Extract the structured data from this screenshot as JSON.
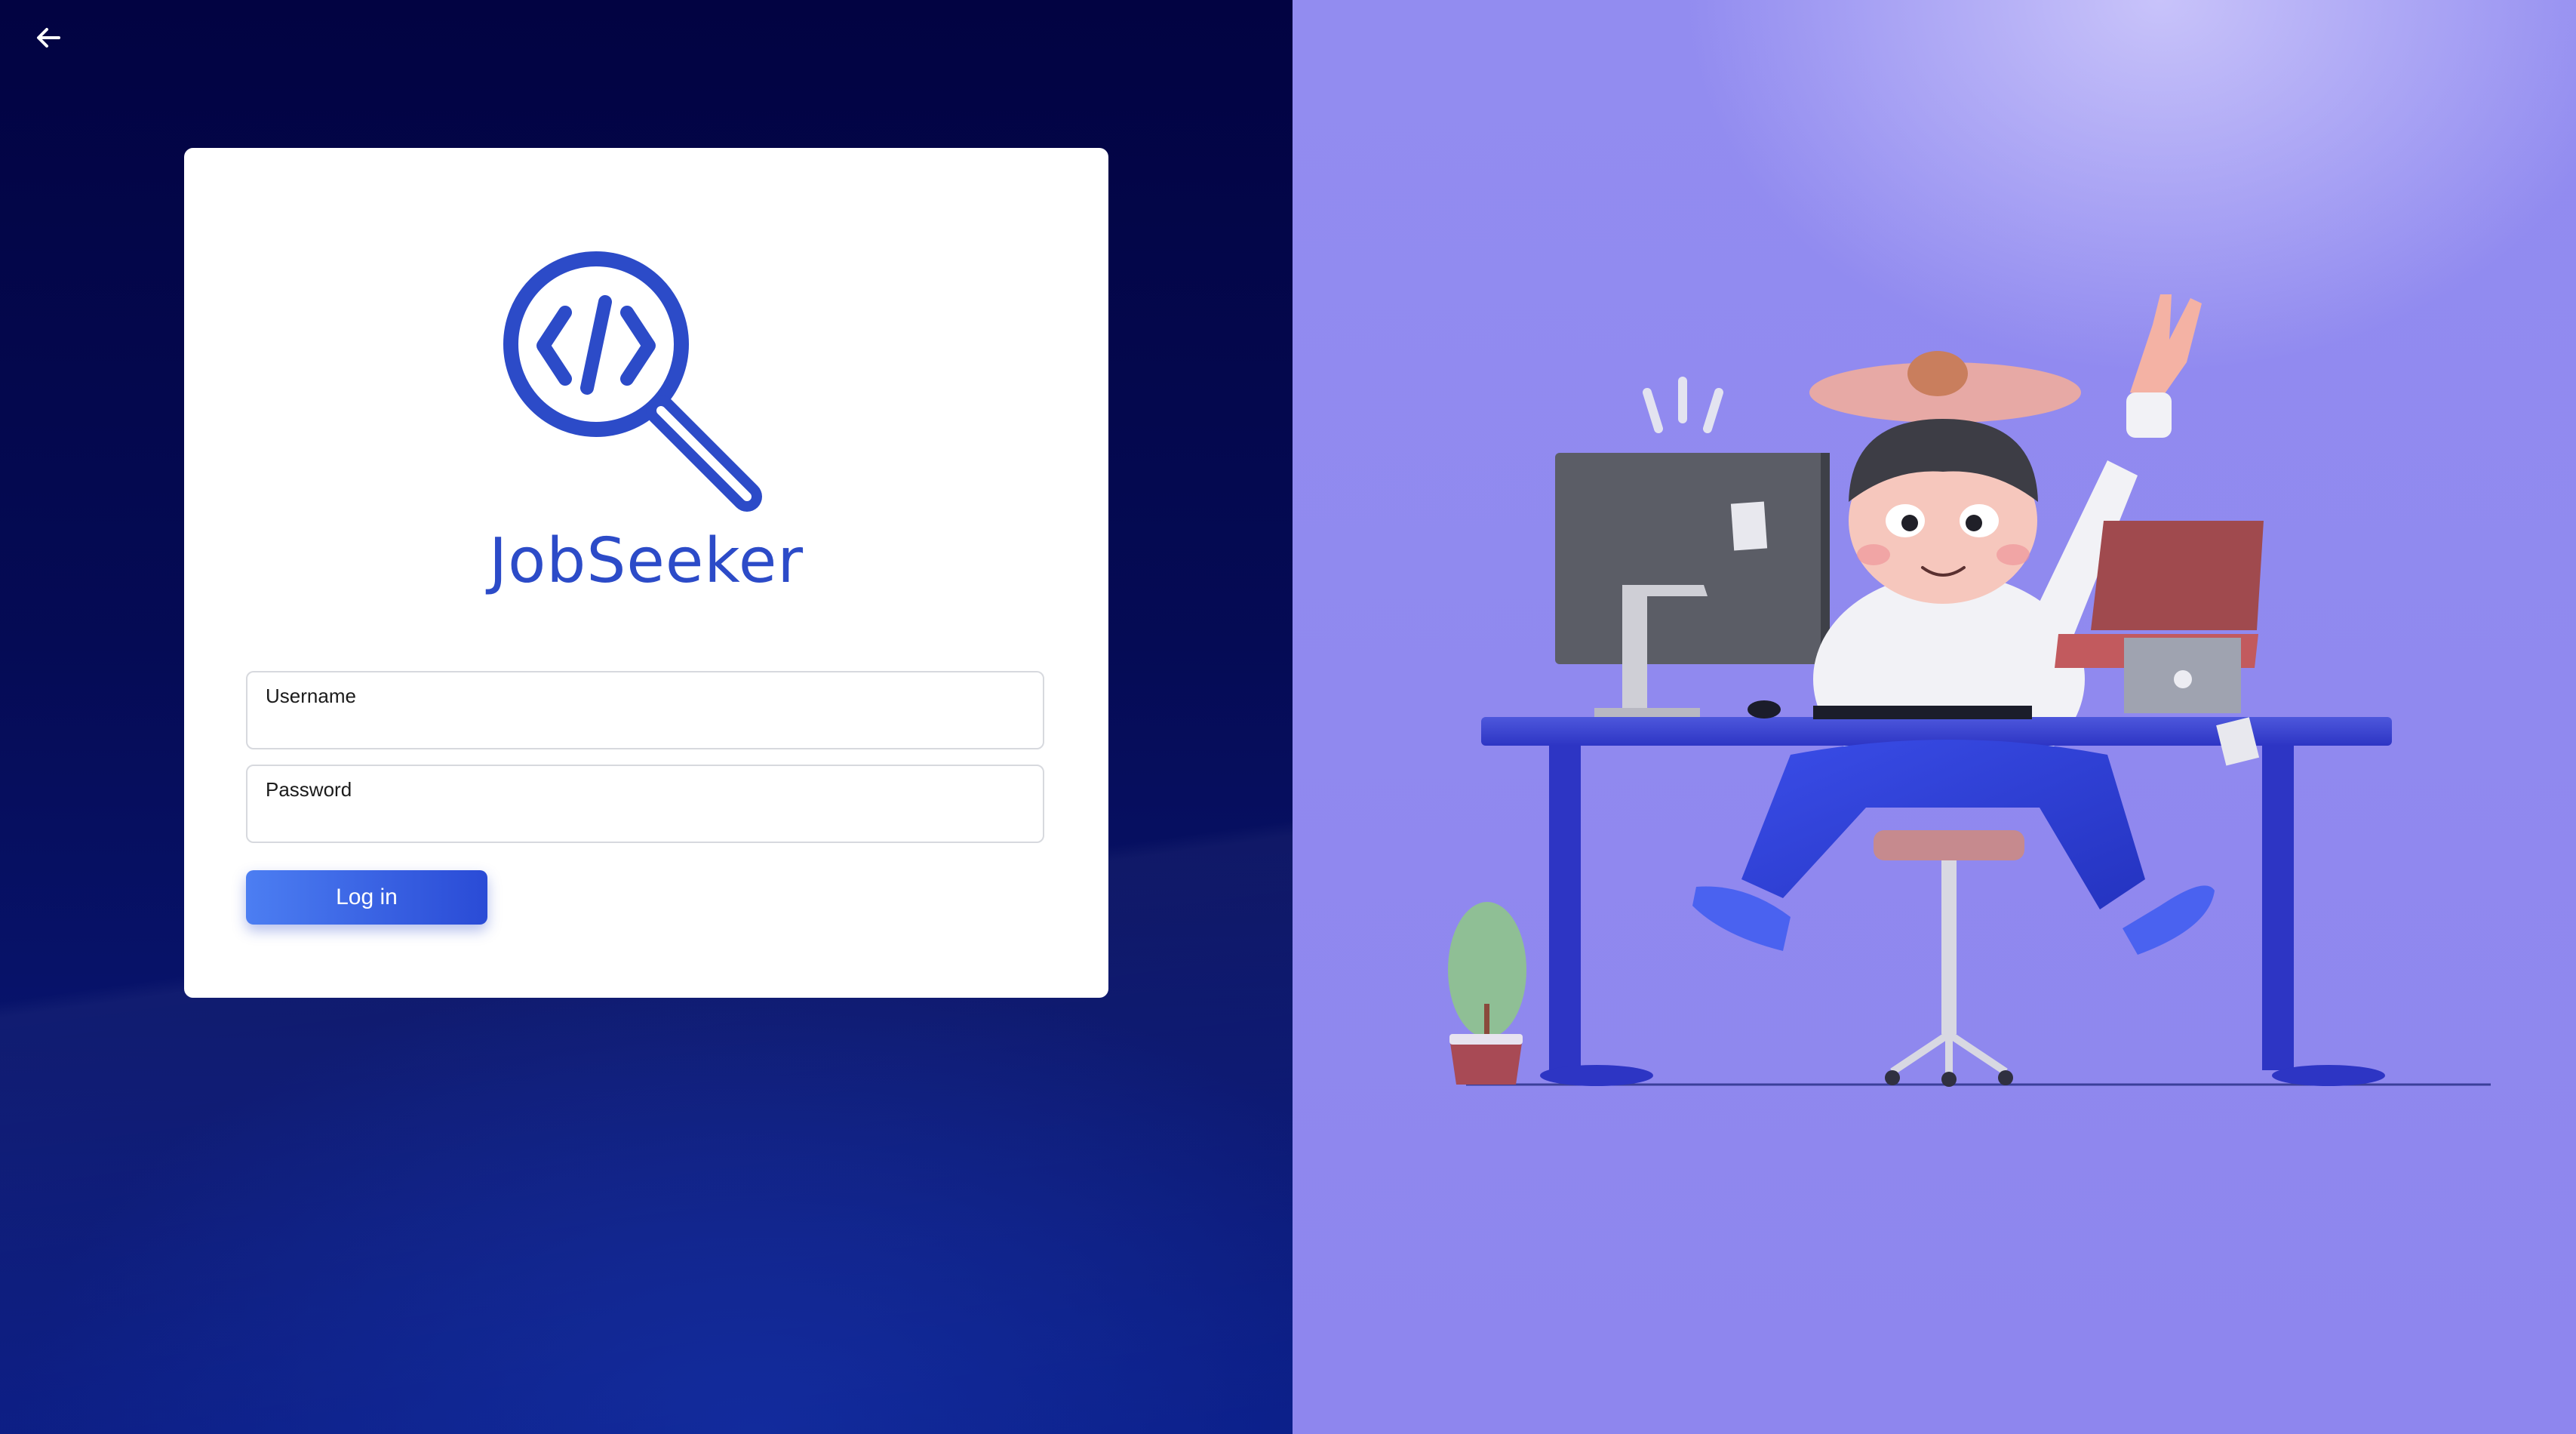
{
  "nav": {
    "back_icon": "arrow-left-icon"
  },
  "brand": {
    "name": "JobSeeker",
    "logo_icon": "magnifier-code-icon",
    "color": "#2c4bc8"
  },
  "form": {
    "username": {
      "label": "Username",
      "value": "",
      "placeholder": ""
    },
    "password": {
      "label": "Password",
      "value": "",
      "placeholder": ""
    },
    "login_label": "Log in"
  },
  "colors": {
    "left_background": "#050b55",
    "right_background": "#8e86ee",
    "button_gradient_start": "#4c7ef2",
    "button_gradient_end": "#2a4bd6"
  },
  "illustration": {
    "subject": "person-at-desk-illustration"
  }
}
